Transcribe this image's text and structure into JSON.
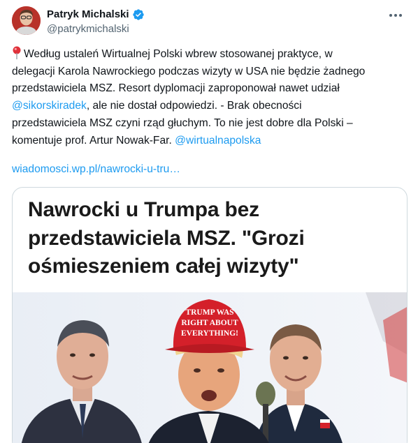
{
  "author": {
    "display_name": "Patryk Michalski",
    "handle": "@patrykmichalski",
    "verified": true
  },
  "tweet": {
    "pin_emoji": "pushpin-icon",
    "lines": [
      [
        {
          "t": "Według ustaleń Wirtualnej Polski wbrew stosowanej praktyce, w"
        }
      ],
      [
        {
          "t": "delegacji Karola Nawrockiego podczas wizyty w USA nie będzie żadnego"
        }
      ],
      [
        {
          "t": "przedstawiciela MSZ. Resort dyplomacji zaproponował nawet udział"
        }
      ],
      [
        {
          "t": "@sikorskiradek",
          "mention": true
        },
        {
          "t": ", ale nie dostał odpowiedzi. - Brak obecności"
        }
      ],
      [
        {
          "t": "przedstawiciela MSZ czyni rząd głuchym. To nie jest dobre dla Polski –"
        }
      ],
      [
        {
          "t": "komentuje prof. Artur Nowak-Far. "
        },
        {
          "t": "@wirtualnapolska",
          "mention": true
        }
      ]
    ],
    "link_text": "wiadomosci.wp.pl/nawrocki-u-tru…"
  },
  "card": {
    "headline_lines": [
      "Nawrocki u Trumpa bez",
      "przedstawiciela MSZ. \"Grozi",
      "ośmieszeniem całej wizyty\""
    ],
    "hat_text_lines": [
      "TRUMP WAS",
      "RIGHT ABOUT",
      "EVERYTHING!"
    ]
  },
  "colors": {
    "accent": "#1d9bf0",
    "verified": "#1d9bf0",
    "hat_red": "#d4202a",
    "pin_red": "#e0313a"
  }
}
